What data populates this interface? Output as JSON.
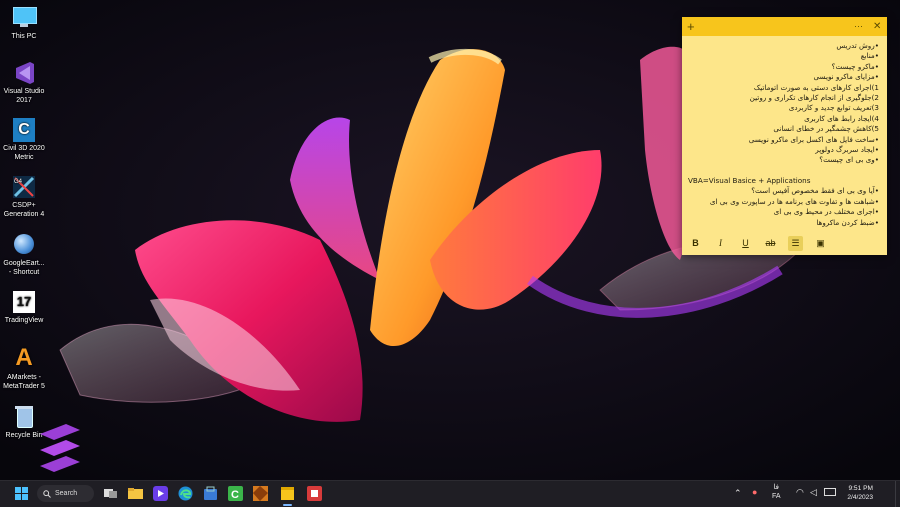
{
  "desktop": {
    "icons": [
      {
        "name": "this-pc",
        "label": "This PC",
        "icon": "monitor-icon",
        "color": "#4fc3f7"
      },
      {
        "name": "visual-studio",
        "label": "Visual Studio\n2017",
        "icon": "visual-studio-icon",
        "color": "#7a45c6"
      },
      {
        "name": "civil3d",
        "label": "Civil 3D 2020\nMetric",
        "icon": "civil3d-icon",
        "color": "#1e7fc3"
      },
      {
        "name": "csdp",
        "label": "CSDP+\nGeneration 4",
        "icon": "csdp-icon",
        "color": "#6ec1e4"
      },
      {
        "name": "google-earth",
        "label": "GoogleEart...\n- Shortcut",
        "icon": "globe-icon",
        "color": "#4a8fd8"
      },
      {
        "name": "tradingview",
        "label": "TradingView",
        "icon": "tradingview-icon",
        "color": "#ffffff"
      },
      {
        "name": "amarkets",
        "label": "AMarkets -\nMetaTrader 5",
        "icon": "amarkets-icon",
        "color": "#f49a23"
      },
      {
        "name": "recycle-bin",
        "label": "Recycle Bin",
        "icon": "recycle-bin-icon",
        "color": "#a0c4e8"
      }
    ]
  },
  "sticky_note": {
    "header_add": "+",
    "header_menu": "···",
    "header_close": "✕",
    "lines": [
      "•روش تدریس",
      "•منابع",
      "•ماکرو چیست؟",
      "•مزایای ماکرو نویسی",
      "1)اجرای کارهای دستی به صورت اتوماتیک",
      "2)جلوگیری از انجام کارهای تکراری و روتین",
      "3)تعریف توابع جدید و کاربردی",
      "4)ایجاد رابط های کاربری",
      "5)کاهش چشمگیر در خطای انسانی",
      "•ساخت فایل های اکسل برای ماکرو نویسی",
      "•ایجاد سربرگ دولوپر",
      "•وی بی ای چیست؟",
      "",
      "VBA=Visual Basice + Applications",
      "•آیا وی بی ای فقط مخصوص آفیس است؟",
      "•شباهت ها و تفاوت های برنامه ها در ساپورت وی بی ای",
      "•اجرای مختلف در محیط وی بی ای",
      "•ضبط کردن ماکروها"
    ],
    "toolbar": {
      "bold": "B",
      "italic": "I",
      "underline": "U",
      "strike": "ab",
      "list": "☰",
      "image": "▣"
    }
  },
  "taskbar": {
    "search_label": "Search",
    "language": "FA",
    "language_top": "فا",
    "time": "9:51 PM",
    "date": "2/4/2023"
  }
}
